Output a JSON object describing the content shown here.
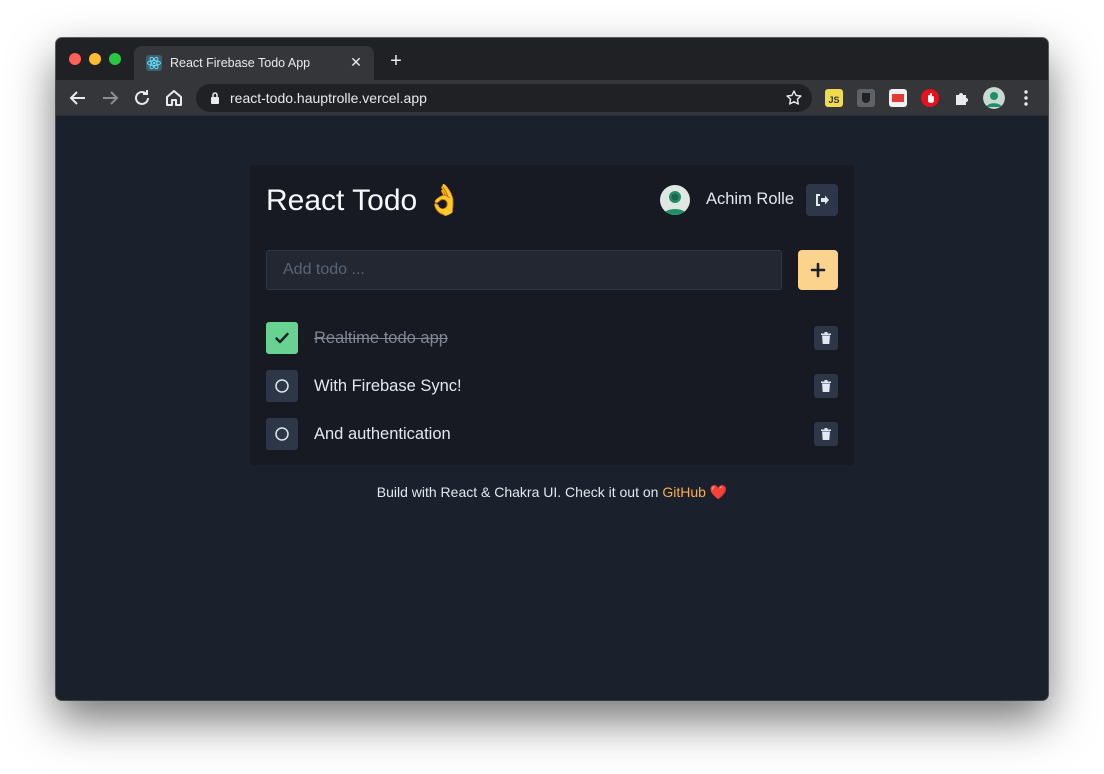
{
  "browser": {
    "tab_title": "React Firebase Todo App",
    "url": "react-todo.hauptrolle.vercel.app"
  },
  "app": {
    "title": "React Todo",
    "title_emoji": "👌",
    "user_name": "Achim Rolle",
    "input_placeholder": "Add todo ...",
    "input_value": "",
    "todos": [
      {
        "text": "Realtime todo app",
        "done": true
      },
      {
        "text": "With Firebase Sync!",
        "done": false
      },
      {
        "text": "And authentication",
        "done": false
      }
    ]
  },
  "footer": {
    "text": "Build with React & Chakra UI. Check it out on ",
    "link_text": "GitHub",
    "emoji": "❤️"
  },
  "colors": {
    "background": "#1a202c",
    "card": "#171923",
    "accent_add": "#fbd38d",
    "checkbox_done": "#68d391",
    "link": "#f6ad55"
  }
}
